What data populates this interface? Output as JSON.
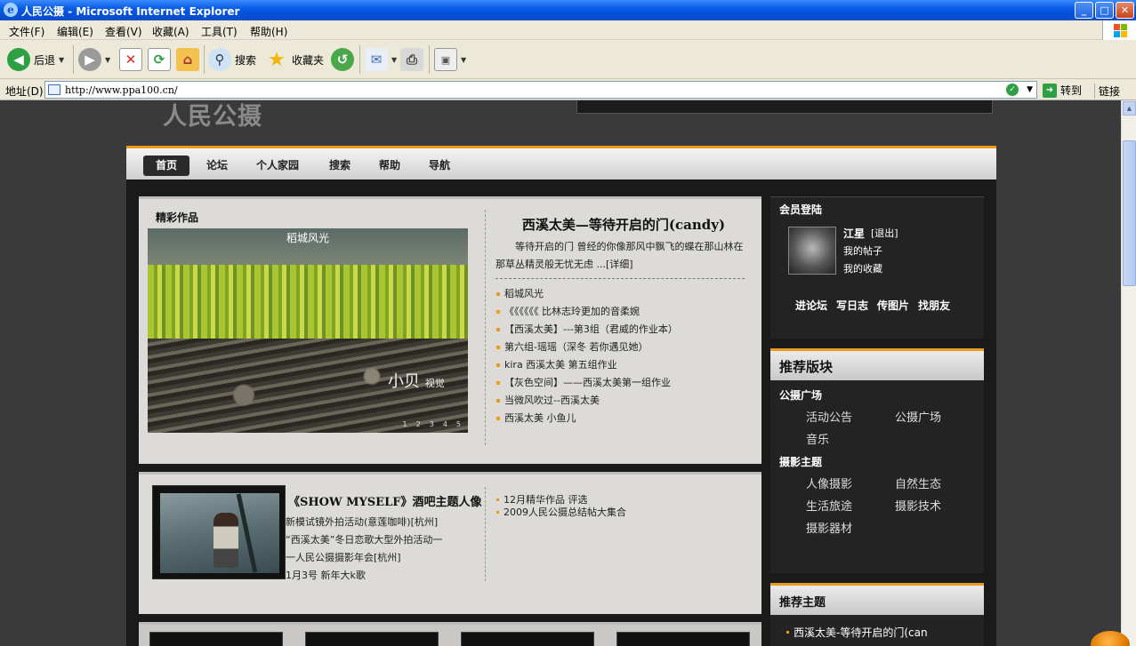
{
  "window": {
    "title": "人民公摄 - Microsoft Internet Explorer",
    "buttons": [
      "_",
      "□",
      "✕"
    ]
  },
  "menubar": [
    "文件(F)",
    "编辑(E)",
    "查看(V)",
    "收藏(A)",
    "工具(T)",
    "帮助(H)"
  ],
  "toolbar": {
    "back": "后退",
    "search": "搜索",
    "favorites": "收藏夹"
  },
  "address": {
    "label": "地址(D)",
    "url": "http://www.ppa100.cn/",
    "go": "转到",
    "links": "链接"
  },
  "site": {
    "logo": "人民公摄",
    "nav": [
      "首页",
      "论坛",
      "个人家园",
      "搜索",
      "帮助",
      "导航"
    ]
  },
  "featured": {
    "section_title": "精彩作品",
    "photo_caption": "稻城风光",
    "photo_signature": "小贝",
    "photo_signature_sub": "视觉",
    "pager": [
      "1",
      "2",
      "3",
      "4",
      "5"
    ],
    "title": "西溪太美—等待开启的门(candy)",
    "desc": "等待开启的门 曾经的你像那风中飘飞的蝶在那山林在那草丛精灵般无忧无虑 ...[详细]",
    "list": [
      "稻城风光",
      "《《《《《《 比林志玲更加的音柔婉",
      "【西溪太美】---第3组（君威的作业本）",
      "第六组-瑶瑶（深冬 若你遇见她）",
      "kira 西溪太美 第五组作业",
      "【灰色空间】——西溪太美第一组作业",
      "当微风吹过--西溪太美",
      "西溪太美 小鱼儿"
    ]
  },
  "events": {
    "title": "《SHOW MYSELF》酒吧主题人像",
    "lines": [
      "新模试镜外拍活动(意莲咖啡)[杭州]",
      "“西溪太美”冬日恋歌大型外拍活动一",
      "一人民公摄摄影年会[杭州]",
      "1月3号 新年大k歌"
    ],
    "list": [
      "12月精华作品 评选",
      "2009人民公摄总结帖大集合"
    ]
  },
  "login": {
    "title": "会员登陆",
    "username": "江星",
    "logout": "[退出]",
    "links": [
      "我的帖子",
      "我的收藏"
    ],
    "actions": [
      "进论坛",
      "写日志",
      "传图片",
      "找朋友"
    ]
  },
  "rec_boards": {
    "title": "推荐版块",
    "groups": [
      {
        "name": "公摄广场",
        "items": [
          "活动公告",
          "公摄广场",
          "音乐"
        ]
      },
      {
        "name": "摄影主题",
        "items": [
          "人像摄影",
          "自然生态",
          "生活旅途",
          "摄影技术",
          "摄影器材"
        ]
      }
    ]
  },
  "rec_topics": {
    "title": "推荐主题",
    "first": "西溪太美-等待开启的门(can"
  }
}
